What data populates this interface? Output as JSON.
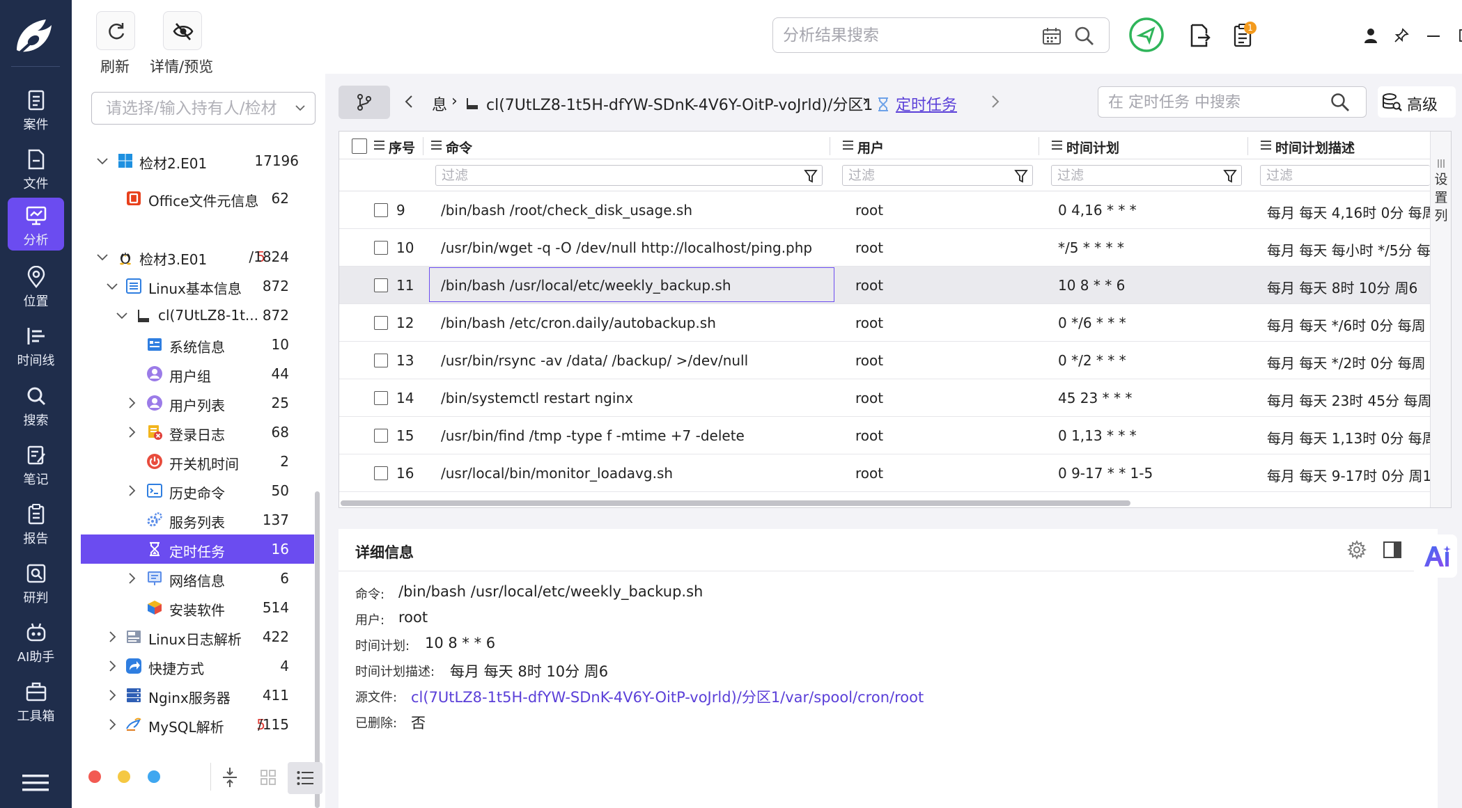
{
  "toolbar": {
    "refresh_label": "刷新",
    "detail_preview_label": "详情/预览",
    "search_placeholder": "分析结果搜索",
    "badge_count": "1"
  },
  "nav": {
    "items": [
      {
        "label": "案件",
        "icon": "case-icon"
      },
      {
        "label": "文件",
        "icon": "file-icon"
      },
      {
        "label": "分析",
        "icon": "analysis-icon",
        "active": true
      },
      {
        "label": "位置",
        "icon": "location-icon"
      },
      {
        "label": "时间线",
        "icon": "timeline-icon"
      },
      {
        "label": "搜索",
        "icon": "search-icon"
      },
      {
        "label": "笔记",
        "icon": "notes-icon"
      },
      {
        "label": "报告",
        "icon": "report-icon"
      },
      {
        "label": "研判",
        "icon": "judgement-icon"
      },
      {
        "label": "AI助手",
        "icon": "ai-assistant-icon"
      },
      {
        "label": "工具箱",
        "icon": "toolbox-icon"
      }
    ]
  },
  "tree": {
    "owner_placeholder": "请选择/输入持有人/检材",
    "nodes": [
      {
        "label": "检材2.E01",
        "count": "17196"
      },
      {
        "label": "Office文件元信息",
        "count": "62"
      },
      {
        "label": "检材3.E01",
        "count_red": "5",
        "count": "/1824"
      },
      {
        "label": "Linux基本信息",
        "count": "872"
      },
      {
        "label": "cl(7UtLZ8-1t...",
        "count": "872"
      },
      {
        "label": "系统信息",
        "count": "10"
      },
      {
        "label": "用户组",
        "count": "44"
      },
      {
        "label": "用户列表",
        "count": "25"
      },
      {
        "label": "登录日志",
        "count": "68"
      },
      {
        "label": "开关机时间",
        "count": "2"
      },
      {
        "label": "历史命令",
        "count": "50"
      },
      {
        "label": "服务列表",
        "count": "137"
      },
      {
        "label": "定时任务",
        "count": "16",
        "selected": true
      },
      {
        "label": "网络信息",
        "count": "6"
      },
      {
        "label": "安装软件",
        "count": "514"
      },
      {
        "label": "Linux日志解析",
        "count": "422"
      },
      {
        "label": "快捷方式",
        "count": "4"
      },
      {
        "label": "Nginx服务器",
        "count": "411"
      },
      {
        "label": "MySQL解析",
        "count_red": "5",
        "count": "/115"
      }
    ]
  },
  "breadcrumb": {
    "part1": "息",
    "part2": "cl(7UtLZ8-1t5H-dfYW-SDnK-4V6Y-OitP-voJrld)/分区1",
    "current": "定时任务"
  },
  "table_search": {
    "placeholder": "在 定时任务 中搜索",
    "advanced_label": "高级"
  },
  "table": {
    "headers": {
      "index": "序号",
      "command": "命令",
      "user": "用户",
      "schedule": "时间计划",
      "schedule_desc": "时间计划描述"
    },
    "filter_placeholder": "过滤",
    "column_settings_label": "设置列",
    "rows": [
      {
        "index": "9",
        "command": "/bin/bash /root/check_disk_usage.sh",
        "user": "root",
        "schedule": "0 4,16 * * *",
        "schedule_desc": "每月 每天 4,16时 0分 每周"
      },
      {
        "index": "10",
        "command": "/usr/bin/wget -q -O /dev/null http://localhost/ping.php",
        "user": "root",
        "schedule": "*/5 * * * *",
        "schedule_desc": "每月 每天 每小时 */5分 每"
      },
      {
        "index": "11",
        "command": "/bin/bash /usr/local/etc/weekly_backup.sh",
        "user": "root",
        "schedule": "10 8 * * 6",
        "schedule_desc": "每月 每天 8时 10分 周6"
      },
      {
        "index": "12",
        "command": "/bin/bash /etc/cron.daily/autobackup.sh",
        "user": "root",
        "schedule": "0 */6 * * *",
        "schedule_desc": "每月 每天 */6时 0分 每周"
      },
      {
        "index": "13",
        "command": "/usr/bin/rsync -av /data/ /backup/ >/dev/null",
        "user": "root",
        "schedule": "0 */2 * * *",
        "schedule_desc": "每月 每天 */2时 0分 每周"
      },
      {
        "index": "14",
        "command": "/bin/systemctl restart nginx",
        "user": "root",
        "schedule": "45 23 * * *",
        "schedule_desc": "每月 每天 23时 45分 每周"
      },
      {
        "index": "15",
        "command": "/usr/bin/find /tmp -type f -mtime +7 -delete",
        "user": "root",
        "schedule": "0 1,13 * * *",
        "schedule_desc": "每月 每天 1,13时 0分 每周"
      },
      {
        "index": "16",
        "command": "/usr/local/bin/monitor_loadavg.sh",
        "user": "root",
        "schedule": "0 9-17 * * 1-5",
        "schedule_desc": "每月 每天 9-17时 0分 周1"
      }
    ]
  },
  "detail": {
    "title": "详细信息",
    "command_label": "命令:",
    "command": "/bin/bash /usr/local/etc/weekly_backup.sh",
    "user_label": "用户:",
    "user": "root",
    "schedule_label": "时间计划:",
    "schedule": "10 8 * * 6",
    "schedule_desc_label": "时间计划描述:",
    "schedule_desc": "每月 每天 8时 10分 周6",
    "source_label": "源文件:",
    "source": "cl(7UtLZ8-1t5H-dfYW-SDnK-4V6Y-OitP-voJrld)/分区1/var/spool/cron/root",
    "deleted_label": "已删除:",
    "deleted": "否"
  },
  "colors": {
    "nav_bg": "#1f2d4b",
    "accent": "#6b4cf0",
    "link": "#5a3fd8",
    "count_red": "#e0403a"
  }
}
